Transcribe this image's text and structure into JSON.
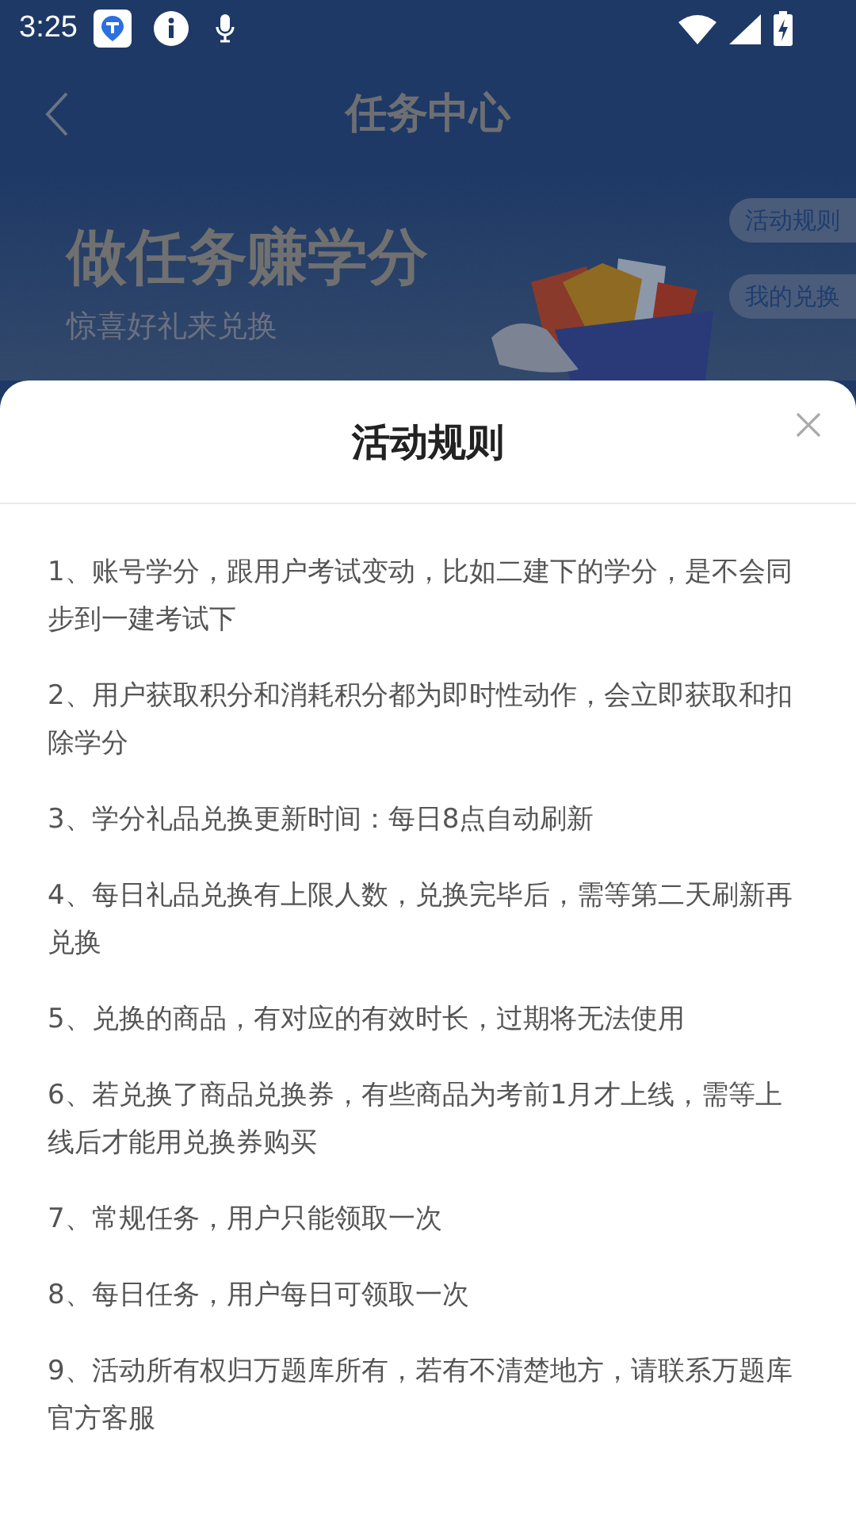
{
  "status_bar": {
    "time": "3:25"
  },
  "header": {
    "title": "任务中心"
  },
  "banner": {
    "headline": "做任务赚学分",
    "subtitle": "惊喜好礼来兑换",
    "side_buttons": [
      "活动规则",
      "我的兑换"
    ]
  },
  "sheet": {
    "title": "活动规则",
    "rules": [
      "1、账号学分，跟用户考试变动，比如二建下的学分，是不会同步到一建考试下",
      "2、用户获取积分和消耗积分都为即时性动作，会立即获取和扣除学分",
      "3、学分礼品兑换更新时间：每日8点自动刷新",
      "4、每日礼品兑换有上限人数，兑换完毕后，需等第二天刷新再兑换",
      "5、兑换的商品，有对应的有效时长，过期将无法使用",
      "6、若兑换了商品兑换券，有些商品为考前1月才上线，需等上线后才能用兑换券购买",
      "7、常规任务，用户只能领取一次",
      "8、每日任务，用户每日可领取一次",
      "9、活动所有权归万题库所有，若有不清楚地方，请联系万题库官方客服"
    ]
  }
}
